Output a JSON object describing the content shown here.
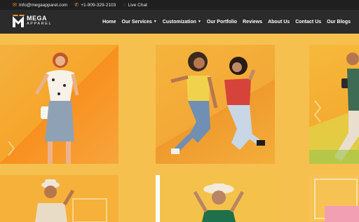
{
  "topbar": {
    "email": "Info@megaapparel.com",
    "phone": "+1-909-329-2103",
    "chat": "Live Chat"
  },
  "logo": {
    "line1": "MEGA",
    "line2": "APPAREL"
  },
  "nav": {
    "items": [
      {
        "label": "Home",
        "dropdown": false
      },
      {
        "label": "Our Services",
        "dropdown": true
      },
      {
        "label": "Customization",
        "dropdown": true
      },
      {
        "label": "Our Portfolio",
        "dropdown": false
      },
      {
        "label": "Reviews",
        "dropdown": false
      },
      {
        "label": "About Us",
        "dropdown": false
      },
      {
        "label": "Contact Us",
        "dropdown": false
      },
      {
        "label": "Our Blogs",
        "dropdown": false
      }
    ]
  },
  "colors": {
    "topbar_bg": "#1f1f1f",
    "navbar_bg": "#2b2b2b",
    "accent": "#f29a2e",
    "page_bg": "#f6c04e"
  }
}
